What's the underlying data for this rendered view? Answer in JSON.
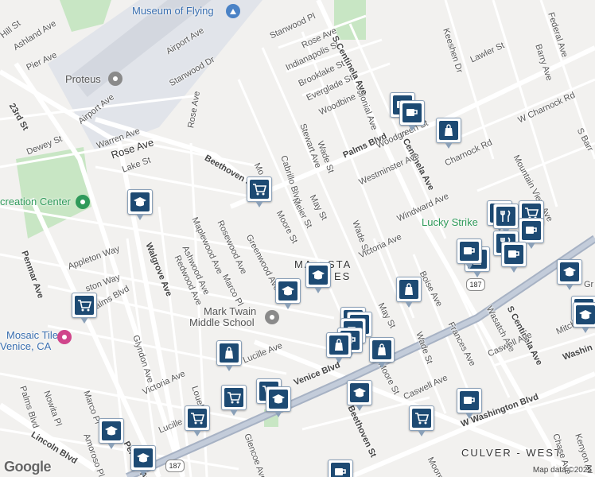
{
  "map": {
    "attribution": "Map data ©2025",
    "logo": "Google",
    "route_badge": "187",
    "pois": {
      "museum": "Museum of Flying",
      "proteus": "Proteus",
      "recreation": "creation Center",
      "lucky": "Lucky Strike",
      "mosaic_line1": "Mosaic Tile",
      "mosaic_line2": "Venice, CA",
      "mark_twain_1": "Mark Twain",
      "mark_twain_2": "Middle School",
      "mar_vista_1": "MA",
      "mar_vista_2": "STA",
      "mar_vista_3": "ES",
      "culver": "CULVER - WEST"
    },
    "streets": {
      "hill": "Hill St",
      "ashland": "Ashland Ave",
      "pier": "Pier Ave",
      "s23rd": "23rd St",
      "dewey": "Dewey St",
      "airport1": "Airport Ave",
      "airport2": "Airport Ave",
      "stanwood_dr": "Stanwood Dr",
      "stanwood_pl": "Stanwood Pl",
      "rose1": "Rose Ave",
      "rose2": "Rose Ave",
      "rose3": "Rose Ave",
      "warren": "Warren Ave",
      "lake": "Lake St",
      "beethoven1": "Beethoven St",
      "beethoven2": "Beethoven St",
      "cabrillo": "Cabrillo Blvd",
      "indianapolis": "Indianapolis St",
      "brooklake": "Brooklake St",
      "everglade": "Everglade St",
      "woodbine": "Woodbine St",
      "colonial": "Colonial Ave",
      "stewart": "Stewart Ave",
      "wade1": "Wade St",
      "wade2": "Wade St",
      "wade3": "Wade St",
      "palms1": "Palms Blvd",
      "palms2": "Palms Blvd",
      "palms3": "Palms Blvd",
      "centinela1": "S Centinela Ave",
      "centinela2": "S Centinela Ave",
      "centinela3": "S Centinela Ave",
      "woodgreen": "Woodgreen St",
      "westminster": "Westminster Ave",
      "charnock_rd": "Charnock Rd",
      "w_charnock": "W Charnock Rd",
      "keeshen": "Keeshen Dr",
      "lawler": "Lawler St",
      "federal": "Federal Ave",
      "barry": "Barry Ave",
      "mountain_view": "Mountain View Ave",
      "s_barry": "S Barr",
      "windward": "Windward Ave",
      "victoria1": "Victoria Ave",
      "victoria2": "Victoria Ave",
      "moore1": "Moore St",
      "moore2": "Moore St",
      "moore3": "Moore St",
      "moore4": "Moore St",
      "meier": "Meier St",
      "may1": "May St",
      "may2": "May St",
      "boise": "Boise Ave",
      "frances": "Frances Ave",
      "wasatch": "Wasatch Ave",
      "caswell1": "Caswell Ave",
      "caswell2": "Caswell Ave",
      "mitchell": "Mitche",
      "washington1": "W Washington Blvd",
      "washington2": "Washin",
      "venice": "Venice Blvd",
      "penmar1": "Penmar Ave",
      "penmar2": "Penmar Ave",
      "walgrove": "Walgrove Ave",
      "appleton": "Appleton Way",
      "ston_way": "ston Way",
      "maplewood": "Maplewood Ave",
      "rosewood": "Rosewood Ave",
      "ashwood": "Ashwood Ave",
      "redwood": "Redwood Ave",
      "greenwood": "Greenwood Ave",
      "marco1": "Marco Pl",
      "marco2": "Marco Pl",
      "lucile1": "Lucille Ave",
      "lucile2": "Lucille",
      "glyndon": "Glyndon Ave",
      "nowita": "Nowita Pl",
      "amoroso": "Amoroso Pl",
      "lincoln": "Lincoln Blvd",
      "louella": "Louella Ave",
      "glencoe": "Glencoe Ave",
      "chase": "Chase Ave",
      "kenyon": "Kenyon Av",
      "mo_st": "Mo",
      "grn": "Gr",
      "palms_blvd_sw": "Palms Blvd"
    }
  }
}
